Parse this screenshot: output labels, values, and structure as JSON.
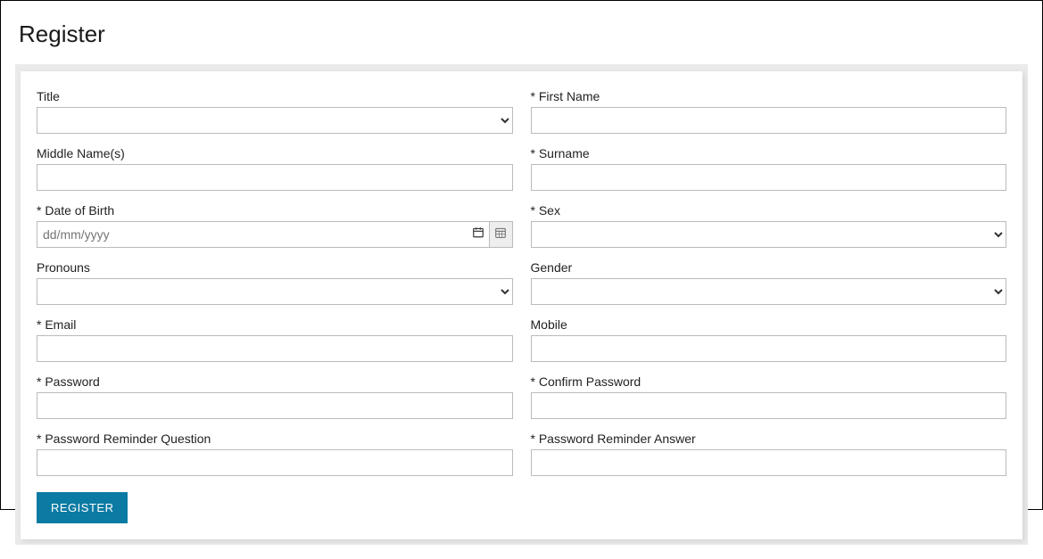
{
  "page": {
    "title": "Register"
  },
  "fields": {
    "title": {
      "label": "Title"
    },
    "firstName": {
      "label": "* First Name"
    },
    "middleNames": {
      "label": "Middle Name(s)"
    },
    "surname": {
      "label": "* Surname"
    },
    "dob": {
      "label": "* Date of Birth",
      "placeholder": "dd/mm/yyyy"
    },
    "sex": {
      "label": "* Sex"
    },
    "pronouns": {
      "label": "Pronouns"
    },
    "gender": {
      "label": "Gender"
    },
    "email": {
      "label": "* Email"
    },
    "mobile": {
      "label": "Mobile"
    },
    "password": {
      "label": "* Password"
    },
    "confirmPassword": {
      "label": "* Confirm Password"
    },
    "reminderQuestion": {
      "label": "* Password Reminder Question"
    },
    "reminderAnswer": {
      "label": "* Password Reminder Answer"
    }
  },
  "buttons": {
    "register": "REGISTER"
  }
}
